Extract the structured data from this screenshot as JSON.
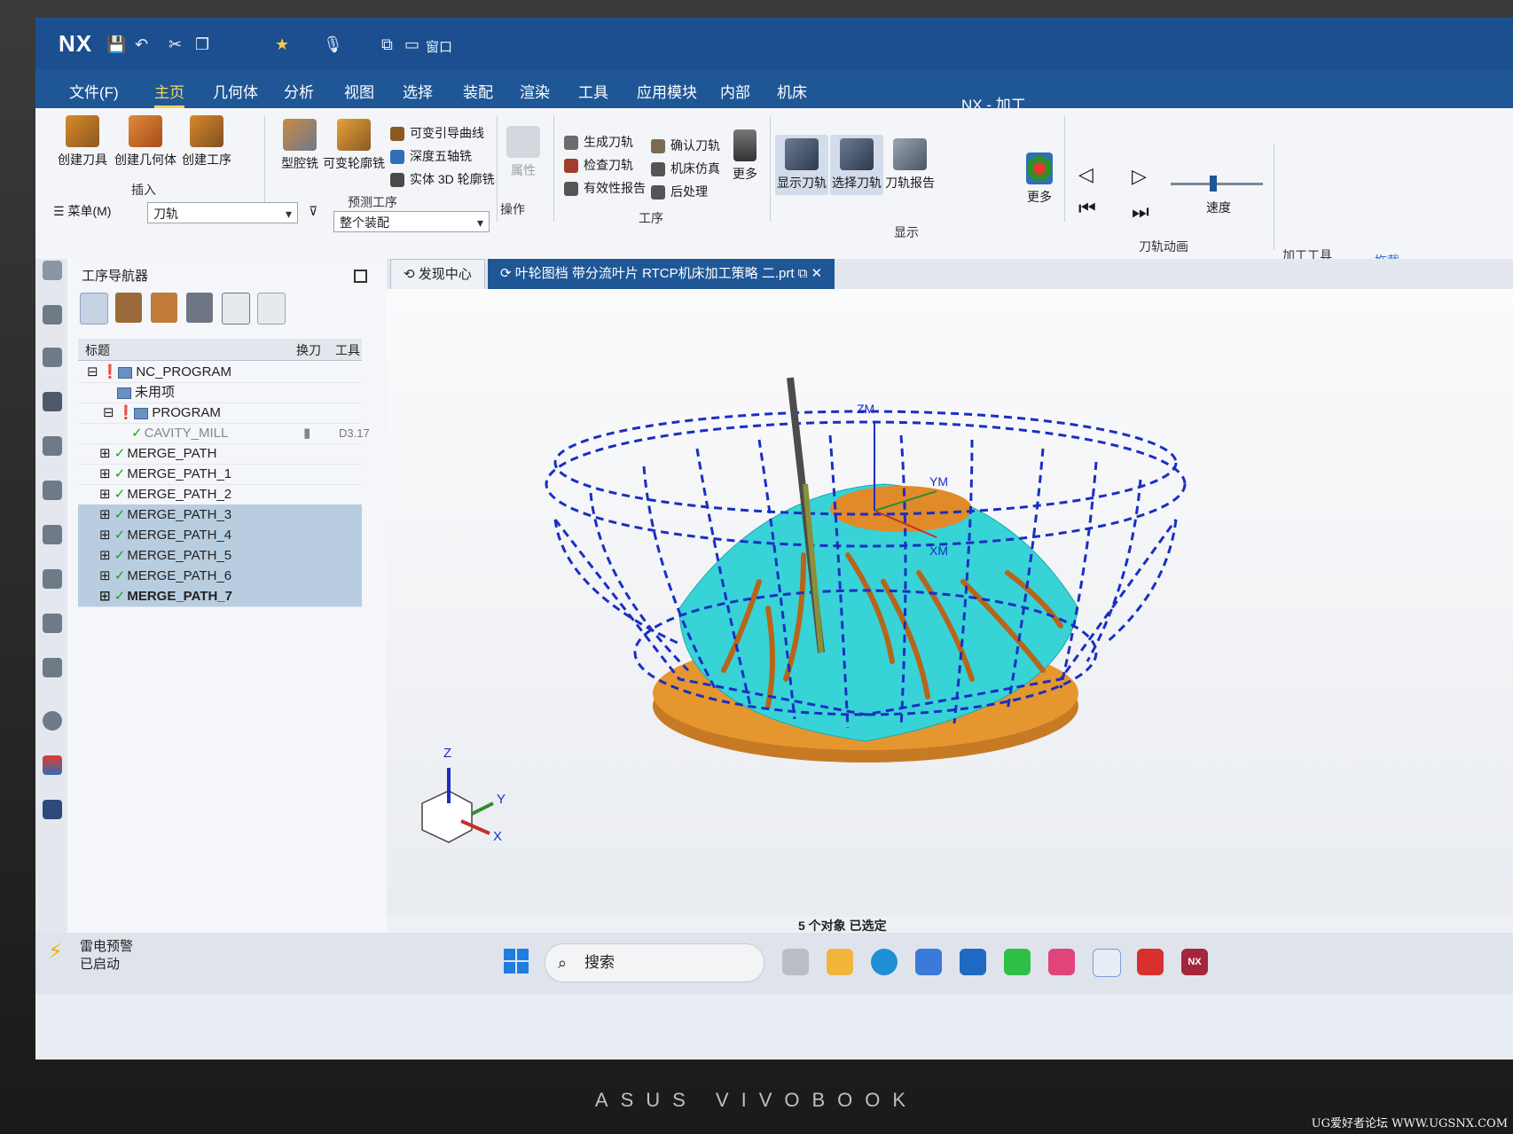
{
  "app": {
    "logo": "NX",
    "title": "NX - 加工",
    "window_menu": "窗口"
  },
  "menu": [
    "文件(F)",
    "主页",
    "几何体",
    "分析",
    "视图",
    "选择",
    "装配",
    "渲染",
    "工具",
    "应用模块",
    "内部",
    "机床"
  ],
  "ribbon": {
    "insert": {
      "create_tool": "创建刀具",
      "create_geometry": "创建几何体",
      "create_operation": "创建工序",
      "label": "插入"
    },
    "pre_ops": {
      "cavity_mill": "型腔铣",
      "variable_contour": "可变轮廓铣",
      "variable_streamline": "可变引导曲线",
      "deep_5axis": "深度五轴铣",
      "solid_3d": "实体 3D 轮廓铣",
      "label": "预测工序"
    },
    "actions": {
      "properties": "属性",
      "label": "操作"
    },
    "operation": {
      "generate": "生成刀轨",
      "verify": "确认刀轨",
      "check": "检查刀轨",
      "machine_sim": "机床仿真",
      "validity_report": "有效性报告",
      "postprocess": "后处理",
      "more": "更多",
      "label": "工序"
    },
    "display": {
      "show_toolpath": "显示刀轨",
      "select_toolpath": "选择刀轨",
      "toolpath_report": "刀轨报告",
      "more": "更多",
      "label": "显示"
    },
    "animation": {
      "speed": "速度",
      "label": "刀轨动画"
    },
    "machining_tools": {
      "label": "加工工具",
      "cut": "拖截"
    }
  },
  "toolbar2": {
    "menu_label": "菜单(M)",
    "filter_type": "刀轨",
    "scope": "整个装配"
  },
  "navigator": {
    "title": "工序导航器",
    "col_name": "标题",
    "col_swap": "换刀",
    "col_tool": "工具",
    "rows": [
      {
        "name": "NC_PROGRAM",
        "kind": "root"
      },
      {
        "name": "未用项",
        "kind": "folder"
      },
      {
        "name": "PROGRAM",
        "kind": "folder"
      },
      {
        "name": "CAVITY_MILL",
        "kind": "op",
        "tool": "D3.17"
      },
      {
        "name": "MERGE_PATH",
        "kind": "op"
      },
      {
        "name": "MERGE_PATH_1",
        "kind": "op"
      },
      {
        "name": "MERGE_PATH_2",
        "kind": "op"
      },
      {
        "name": "MERGE_PATH_3",
        "kind": "op",
        "selected": true
      },
      {
        "name": "MERGE_PATH_4",
        "kind": "op",
        "selected": true
      },
      {
        "name": "MERGE_PATH_5",
        "kind": "op",
        "selected": true
      },
      {
        "name": "MERGE_PATH_6",
        "kind": "op",
        "selected": true
      },
      {
        "name": "MERGE_PATH_7",
        "kind": "op",
        "selected": true
      }
    ]
  },
  "tabs": {
    "home": "发现中心",
    "file": "叶轮图档 带分流叶片 RTCP机床加工策略 二.prt"
  },
  "viewport": {
    "wcs": [
      "ZM",
      "YM",
      "XM"
    ],
    "triad": [
      "Z",
      "Y",
      "X"
    ]
  },
  "status": {
    "selection": "5 个对象 已选定"
  },
  "taskbar": {
    "weather_title": "雷电预警",
    "weather_sub": "已启动",
    "search": "搜索",
    "nx_icon": "NX"
  },
  "device": {
    "brand": "ASUS VIVOBOOK"
  },
  "watermark": "UG爱好者论坛 WWW.UGSNX.COM",
  "colors": {
    "title_bar": "#1b4f8f",
    "toolpath": "#1a2fc2",
    "part": "#33d3d6",
    "blank": "#d9892a",
    "selection": "#b8cde0"
  }
}
